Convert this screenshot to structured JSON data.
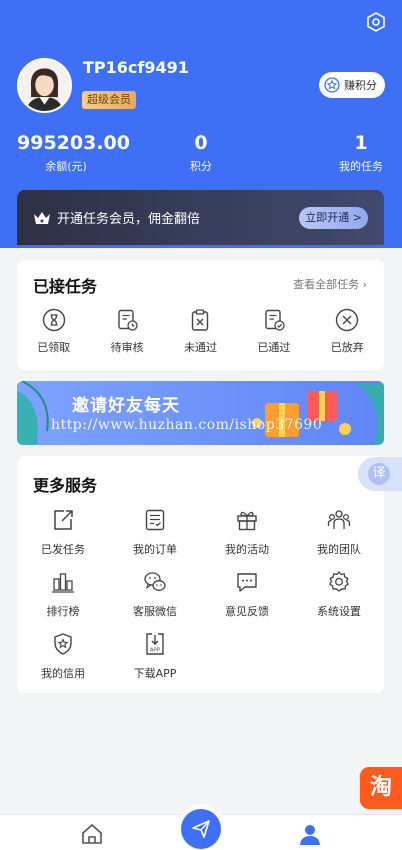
{
  "profile": {
    "username": "TP16cf9491",
    "badge": "超级会员",
    "earn_button": "赚积分"
  },
  "stats": [
    {
      "value": "995203.00",
      "label": "余额(元)"
    },
    {
      "value": "0",
      "label": "积分"
    },
    {
      "value": "1",
      "label": "我的任务"
    }
  ],
  "vip_banner": {
    "text": "开通任务会员，佣金翻倍",
    "button": "立即开通 >"
  },
  "tasks": {
    "title": "已接任务",
    "view_all": "查看全部任务",
    "items": [
      {
        "label": "已领取",
        "icon": "hourglass-icon"
      },
      {
        "label": "待审核",
        "icon": "pending-review-icon"
      },
      {
        "label": "未通过",
        "icon": "rejected-clipboard-icon"
      },
      {
        "label": "已通过",
        "icon": "approved-document-icon"
      },
      {
        "label": "已放弃",
        "icon": "abandon-circle-icon"
      }
    ]
  },
  "promo": {
    "title": "邀请好友每天",
    "watermark": "http://www.huzhan.com/ishop37690"
  },
  "services": {
    "title": "更多服务",
    "items": [
      {
        "label": "已发任务",
        "icon": "publish-icon"
      },
      {
        "label": "我的订单",
        "icon": "order-icon"
      },
      {
        "label": "我的活动",
        "icon": "gift-icon"
      },
      {
        "label": "我的团队",
        "icon": "team-icon"
      },
      {
        "label": "排行榜",
        "icon": "ranking-icon"
      },
      {
        "label": "客服微信",
        "icon": "wechat-icon"
      },
      {
        "label": "意见反馈",
        "icon": "feedback-icon"
      },
      {
        "label": "系统设置",
        "icon": "gear-icon"
      },
      {
        "label": "我的信用",
        "icon": "credit-shield-icon"
      },
      {
        "label": "下载APP",
        "icon": "download-app-icon"
      }
    ]
  },
  "floating": {
    "translate": "译",
    "taobao": "淘"
  },
  "colors": {
    "primary": "#3f6ff5",
    "vip_gold": "#e8a95a",
    "banner_dark": "#2d3046"
  }
}
